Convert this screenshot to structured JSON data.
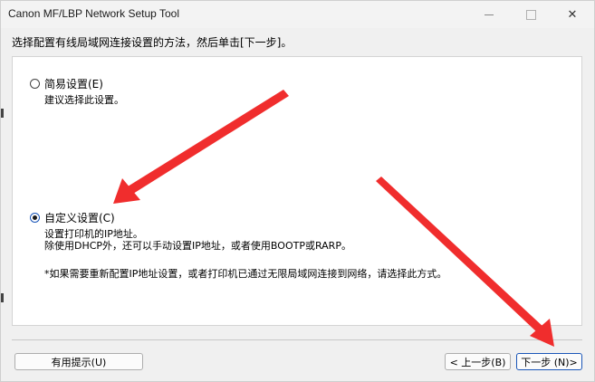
{
  "window": {
    "title": "Canon MF/LBP Network Setup Tool"
  },
  "instruction": "选择配置有线局域网连接设置的方法，然后单击[下一步]。",
  "options": [
    {
      "label": "简易设置(E)",
      "selected": false,
      "description": [
        "建议选择此设置。"
      ]
    },
    {
      "label": "自定义设置(C)",
      "selected": true,
      "description": [
        "设置打印机的IP地址。",
        "除使用DHCP外，还可以手动设置IP地址，或者使用BOOTP或RARP。"
      ]
    }
  ],
  "note": "*如果需要重新配置IP地址设置，或者打印机已通过无限局域网连接到网络，请选择此方式。",
  "buttons": {
    "hint": "有用提示(U)",
    "back": "< 上一步(B)",
    "next": "下一步 (N)>"
  },
  "colors": {
    "annotation_arrow": "#f02d2d",
    "selected_radio": "#1a56b8"
  },
  "icons": {
    "minimize": "minimize-icon",
    "maximize": "maximize-icon",
    "close": "close-icon"
  }
}
